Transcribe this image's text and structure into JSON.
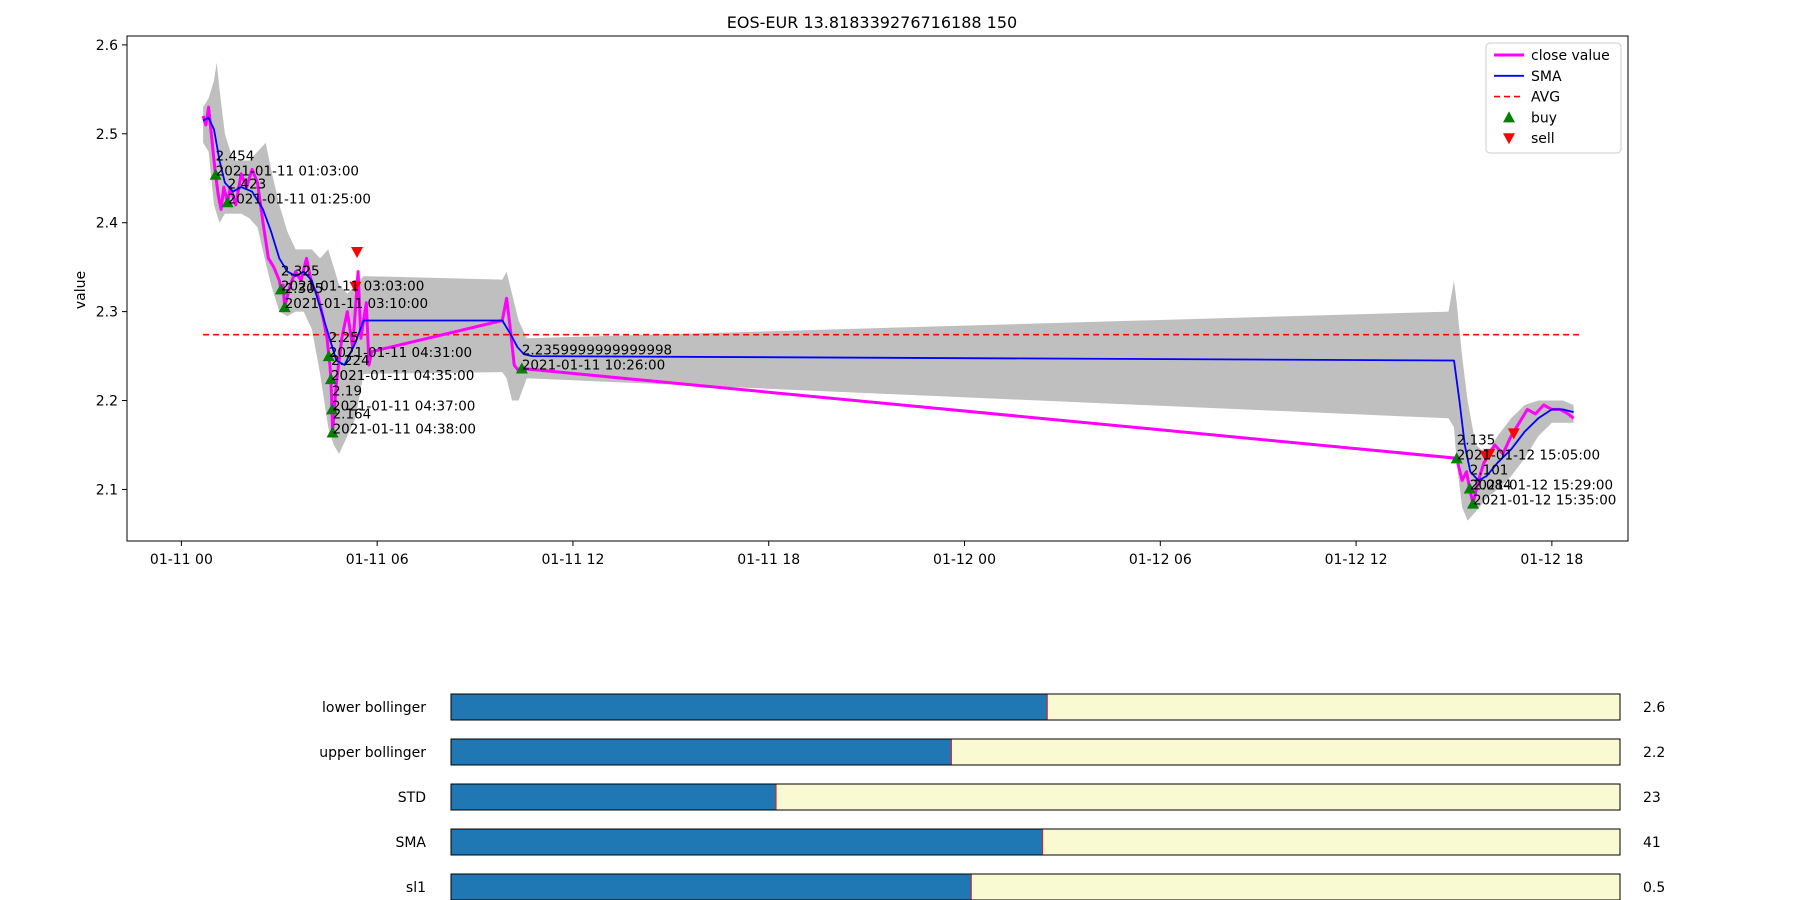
{
  "chart_data": [
    {
      "type": "line",
      "title": "EOS-EUR 13.818339276716188 150",
      "ylabel": "value",
      "xlabel": "",
      "x_axis_type": "datetime",
      "xlim": [
        "2021-01-10 22:20",
        "2021-01-12 20:20"
      ],
      "ylim": [
        2.042,
        2.61
      ],
      "x_ticks": [
        {
          "t": "2021-01-11 00:00",
          "label": "01-11 00"
        },
        {
          "t": "2021-01-11 06:00",
          "label": "01-11 06"
        },
        {
          "t": "2021-01-11 12:00",
          "label": "01-11 12"
        },
        {
          "t": "2021-01-11 18:00",
          "label": "01-11 18"
        },
        {
          "t": "2021-01-12 00:00",
          "label": "01-12 00"
        },
        {
          "t": "2021-01-12 06:00",
          "label": "01-12 06"
        },
        {
          "t": "2021-01-12 12:00",
          "label": "01-12 12"
        },
        {
          "t": "2021-01-12 18:00",
          "label": "01-12 18"
        }
      ],
      "y_ticks": [
        {
          "v": 2.1,
          "label": "2.1"
        },
        {
          "v": 2.2,
          "label": "2.2"
        },
        {
          "v": 2.3,
          "label": "2.3"
        },
        {
          "v": 2.4,
          "label": "2.4"
        },
        {
          "v": 2.5,
          "label": "2.5"
        },
        {
          "v": 2.6,
          "label": "2.6"
        }
      ],
      "legend_position": "top-right",
      "legend": [
        {
          "label": "close value",
          "kind": "line-thick",
          "color": "#ff00ff"
        },
        {
          "label": "SMA",
          "kind": "line",
          "color": "#0000ff"
        },
        {
          "label": "AVG",
          "kind": "dashed",
          "color": "#ff0000"
        },
        {
          "label": "buy",
          "kind": "triangle-up",
          "color": "#008000"
        },
        {
          "label": "sell",
          "kind": "triangle-down",
          "color": "#ff0000"
        }
      ],
      "colors": {
        "close": "#ff00ff",
        "sma": "#0000ff",
        "avg": "#ff0000",
        "band": "#bfbfbf",
        "buy": "#008000",
        "sell": "#ff0000"
      },
      "avg_value": 2.274,
      "avg_range": [
        "2021-01-11 00:40",
        "2021-01-12 18:50"
      ],
      "series": [
        {
          "name": "close value",
          "points": [
            [
              "2021-01-11 00:40",
              2.52
            ],
            [
              "2021-01-11 00:45",
              2.51
            ],
            [
              "2021-01-11 00:50",
              2.53
            ],
            [
              "2021-01-11 00:55",
              2.5
            ],
            [
              "2021-01-11 01:00",
              2.47
            ],
            [
              "2021-01-11 01:03",
              2.454
            ],
            [
              "2021-01-11 01:08",
              2.43
            ],
            [
              "2021-01-11 01:13",
              2.415
            ],
            [
              "2021-01-11 01:18",
              2.44
            ],
            [
              "2021-01-11 01:22",
              2.43
            ],
            [
              "2021-01-11 01:25",
              2.423
            ],
            [
              "2021-01-11 01:30",
              2.44
            ],
            [
              "2021-01-11 01:40",
              2.42
            ],
            [
              "2021-01-11 01:50",
              2.455
            ],
            [
              "2021-01-11 02:00",
              2.44
            ],
            [
              "2021-01-11 02:10",
              2.46
            ],
            [
              "2021-01-11 02:20",
              2.445
            ],
            [
              "2021-01-11 02:30",
              2.4
            ],
            [
              "2021-01-11 02:40",
              2.36
            ],
            [
              "2021-01-11 02:50",
              2.35
            ],
            [
              "2021-01-11 03:00",
              2.335
            ],
            [
              "2021-01-11 03:03",
              2.325
            ],
            [
              "2021-01-11 03:07",
              2.33
            ],
            [
              "2021-01-11 03:10",
              2.305
            ],
            [
              "2021-01-11 03:20",
              2.33
            ],
            [
              "2021-01-11 03:30",
              2.345
            ],
            [
              "2021-01-11 03:40",
              2.335
            ],
            [
              "2021-01-11 03:50",
              2.36
            ],
            [
              "2021-01-11 04:00",
              2.33
            ],
            [
              "2021-01-11 04:10",
              2.32
            ],
            [
              "2021-01-11 04:20",
              2.295
            ],
            [
              "2021-01-11 04:28",
              2.27
            ],
            [
              "2021-01-11 04:31",
              2.25
            ],
            [
              "2021-01-11 04:33",
              2.24
            ],
            [
              "2021-01-11 04:35",
              2.224
            ],
            [
              "2021-01-11 04:37",
              2.19
            ],
            [
              "2021-01-11 04:38",
              2.164
            ],
            [
              "2021-01-11 04:45",
              2.22
            ],
            [
              "2021-01-11 04:55",
              2.27
            ],
            [
              "2021-01-11 05:05",
              2.3
            ],
            [
              "2021-01-11 05:15",
              2.26
            ],
            [
              "2021-01-11 05:25",
              2.345
            ],
            [
              "2021-01-11 05:30",
              2.27
            ],
            [
              "2021-01-11 05:40",
              2.31
            ],
            [
              "2021-01-11 05:45",
              2.24
            ],
            [
              "2021-01-11 05:50",
              2.255
            ],
            [
              "2021-01-11 09:50",
              2.29
            ],
            [
              "2021-01-11 09:58",
              2.315
            ],
            [
              "2021-01-11 10:05",
              2.28
            ],
            [
              "2021-01-11 10:12",
              2.24
            ],
            [
              "2021-01-11 10:18",
              2.235
            ],
            [
              "2021-01-11 10:26",
              2.236
            ],
            [
              "2021-01-12 15:05",
              2.135
            ],
            [
              "2021-01-12 15:15",
              2.11
            ],
            [
              "2021-01-12 15:23",
              2.12
            ],
            [
              "2021-01-12 15:29",
              2.101
            ],
            [
              "2021-01-12 15:35",
              2.084
            ],
            [
              "2021-01-12 15:45",
              2.11
            ],
            [
              "2021-01-12 15:55",
              2.13
            ],
            [
              "2021-01-12 16:05",
              2.14
            ],
            [
              "2021-01-12 16:15",
              2.15
            ],
            [
              "2021-01-12 16:30",
              2.14
            ],
            [
              "2021-01-12 16:45",
              2.16
            ],
            [
              "2021-01-12 17:00",
              2.175
            ],
            [
              "2021-01-12 17:15",
              2.19
            ],
            [
              "2021-01-12 17:30",
              2.185
            ],
            [
              "2021-01-12 17:45",
              2.195
            ],
            [
              "2021-01-12 18:00",
              2.19
            ],
            [
              "2021-01-12 18:15",
              2.19
            ],
            [
              "2021-01-12 18:30",
              2.185
            ],
            [
              "2021-01-12 18:40",
              2.18
            ]
          ]
        },
        {
          "name": "SMA",
          "points": [
            [
              "2021-01-11 00:40",
              2.515
            ],
            [
              "2021-01-11 00:50",
              2.518
            ],
            [
              "2021-01-11 01:00",
              2.505
            ],
            [
              "2021-01-11 01:10",
              2.47
            ],
            [
              "2021-01-11 01:20",
              2.445
            ],
            [
              "2021-01-11 01:35",
              2.435
            ],
            [
              "2021-01-11 01:50",
              2.44
            ],
            [
              "2021-01-11 02:10",
              2.435
            ],
            [
              "2021-01-11 02:30",
              2.415
            ],
            [
              "2021-01-11 02:45",
              2.39
            ],
            [
              "2021-01-11 03:00",
              2.36
            ],
            [
              "2021-01-11 03:15",
              2.345
            ],
            [
              "2021-01-11 03:30",
              2.34
            ],
            [
              "2021-01-11 03:45",
              2.345
            ],
            [
              "2021-01-11 04:00",
              2.335
            ],
            [
              "2021-01-11 04:15",
              2.305
            ],
            [
              "2021-01-11 04:30",
              2.275
            ],
            [
              "2021-01-11 04:45",
              2.245
            ],
            [
              "2021-01-11 05:00",
              2.24
            ],
            [
              "2021-01-11 05:20",
              2.265
            ],
            [
              "2021-01-11 05:35",
              2.29
            ],
            [
              "2021-01-11 09:50",
              2.29
            ],
            [
              "2021-01-11 10:05",
              2.275
            ],
            [
              "2021-01-11 10:18",
              2.26
            ],
            [
              "2021-01-11 10:30",
              2.252
            ],
            [
              "2021-01-11 10:45",
              2.25
            ],
            [
              "2021-01-12 15:00",
              2.245
            ],
            [
              "2021-01-12 15:10",
              2.2
            ],
            [
              "2021-01-12 15:20",
              2.15
            ],
            [
              "2021-01-12 15:30",
              2.12
            ],
            [
              "2021-01-12 15:45",
              2.11
            ],
            [
              "2021-01-12 16:00",
              2.115
            ],
            [
              "2021-01-12 16:20",
              2.13
            ],
            [
              "2021-01-12 16:45",
              2.145
            ],
            [
              "2021-01-12 17:10",
              2.165
            ],
            [
              "2021-01-12 17:35",
              2.18
            ],
            [
              "2021-01-12 18:00",
              2.19
            ],
            [
              "2021-01-12 18:20",
              2.19
            ],
            [
              "2021-01-12 18:40",
              2.187
            ]
          ]
        }
      ],
      "band": [
        [
          "2021-01-11 00:40",
          2.49,
          2.53
        ],
        [
          "2021-01-11 00:50",
          2.48,
          2.54
        ],
        [
          "2021-01-11 01:00",
          2.42,
          2.56
        ],
        [
          "2021-01-11 01:05",
          2.41,
          2.58
        ],
        [
          "2021-01-11 01:10",
          2.4,
          2.55
        ],
        [
          "2021-01-11 01:20",
          2.41,
          2.5
        ],
        [
          "2021-01-11 01:35",
          2.41,
          2.47
        ],
        [
          "2021-01-11 01:50",
          2.41,
          2.47
        ],
        [
          "2021-01-11 02:05",
          2.405,
          2.47
        ],
        [
          "2021-01-11 02:20",
          2.395,
          2.48
        ],
        [
          "2021-01-11 02:35",
          2.355,
          2.49
        ],
        [
          "2021-01-11 02:45",
          2.33,
          2.46
        ],
        [
          "2021-01-11 03:00",
          2.3,
          2.42
        ],
        [
          "2021-01-11 03:15",
          2.295,
          2.39
        ],
        [
          "2021-01-11 03:30",
          2.3,
          2.37
        ],
        [
          "2021-01-11 03:45",
          2.3,
          2.37
        ],
        [
          "2021-01-11 04:00",
          2.28,
          2.37
        ],
        [
          "2021-01-11 04:15",
          2.23,
          2.36
        ],
        [
          "2021-01-11 04:30",
          2.17,
          2.37
        ],
        [
          "2021-01-11 04:40",
          2.15,
          2.35
        ],
        [
          "2021-01-11 04:50",
          2.14,
          2.33
        ],
        [
          "2021-01-11 05:05",
          2.16,
          2.32
        ],
        [
          "2021-01-11 05:20",
          2.18,
          2.33
        ],
        [
          "2021-01-11 05:35",
          2.23,
          2.34
        ],
        [
          "2021-01-11 09:50",
          2.232,
          2.336
        ],
        [
          "2021-01-11 09:58",
          2.225,
          2.345
        ],
        [
          "2021-01-11 10:08",
          2.2,
          2.32
        ],
        [
          "2021-01-11 10:20",
          2.2,
          2.29
        ],
        [
          "2021-01-11 10:35",
          2.225,
          2.27
        ],
        [
          "2021-01-12 14:50",
          2.18,
          2.3
        ],
        [
          "2021-01-12 15:00",
          2.17,
          2.335
        ],
        [
          "2021-01-12 15:05",
          2.13,
          2.31
        ],
        [
          "2021-01-12 15:15",
          2.08,
          2.25
        ],
        [
          "2021-01-12 15:25",
          2.065,
          2.2
        ],
        [
          "2021-01-12 15:40",
          2.075,
          2.15
        ],
        [
          "2021-01-12 16:00",
          2.09,
          2.14
        ],
        [
          "2021-01-12 16:20",
          2.1,
          2.16
        ],
        [
          "2021-01-12 16:45",
          2.115,
          2.18
        ],
        [
          "2021-01-12 17:10",
          2.135,
          2.195
        ],
        [
          "2021-01-12 17:35",
          2.16,
          2.2
        ],
        [
          "2021-01-12 18:00",
          2.175,
          2.2
        ],
        [
          "2021-01-12 18:20",
          2.175,
          2.2
        ],
        [
          "2021-01-12 18:40",
          2.175,
          2.195
        ]
      ],
      "buys": [
        {
          "t": "2021-01-11 01:03",
          "v": 2.454,
          "value_label": "2.454",
          "time_label": "2021-01-11 01:03:00"
        },
        {
          "t": "2021-01-11 01:25",
          "v": 2.423,
          "value_label": "2.423",
          "time_label": "2021-01-11 01:25:00"
        },
        {
          "t": "2021-01-11 03:03",
          "v": 2.325,
          "value_label": "2.325",
          "time_label": "2021-01-11 03:03:00"
        },
        {
          "t": "2021-01-11 03:10",
          "v": 2.305,
          "value_label": "2.305",
          "time_label": "2021-01-11 03:10:00"
        },
        {
          "t": "2021-01-11 04:31",
          "v": 2.25,
          "value_label": "2.25",
          "time_label": "2021-01-11 04:31:00"
        },
        {
          "t": "2021-01-11 04:35",
          "v": 2.224,
          "value_label": "2.224",
          "time_label": "2021-01-11 04:35:00"
        },
        {
          "t": "2021-01-11 04:37",
          "v": 2.19,
          "value_label": "2.19",
          "time_label": "2021-01-11 04:37:00"
        },
        {
          "t": "2021-01-11 04:38",
          "v": 2.164,
          "value_label": "2.164",
          "time_label": "2021-01-11 04:38:00"
        },
        {
          "t": "2021-01-11 10:26",
          "v": 2.236,
          "value_label": "2.2359999999999998",
          "time_label": "2021-01-11 10:26:00"
        },
        {
          "t": "2021-01-12 15:05",
          "v": 2.135,
          "value_label": "2.135",
          "time_label": "2021-01-12 15:05:00"
        },
        {
          "t": "2021-01-12 15:29",
          "v": 2.101,
          "value_label": "2.101",
          "time_label": "2021-01-12 15:29:00"
        },
        {
          "t": "2021-01-12 15:35",
          "v": 2.084,
          "value_label": "2.084",
          "time_label": "2021-01-12 15:35:00"
        }
      ],
      "sells": [
        {
          "t": "2021-01-11 05:23",
          "v": 2.367
        },
        {
          "t": "2021-01-11 05:20",
          "v": 2.328
        },
        {
          "t": "2021-01-12 16:05",
          "v": 2.14
        },
        {
          "t": "2021-01-12 15:58",
          "v": 2.138
        },
        {
          "t": "2021-01-12 16:50",
          "v": 2.163
        }
      ]
    },
    {
      "type": "bar",
      "orientation": "horizontal",
      "colors": {
        "fill": "#1f77b4",
        "remainder": "#fafad2",
        "marker": "#d62728"
      },
      "categories": [
        "lower bollinger",
        "upper bollinger",
        "STD",
        "SMA",
        "sl1"
      ],
      "fractions": [
        0.51,
        0.428,
        0.278,
        0.506,
        0.445
      ],
      "value_labels": [
        "2.6",
        "2.2",
        "23",
        "41",
        "0.5"
      ]
    }
  ]
}
